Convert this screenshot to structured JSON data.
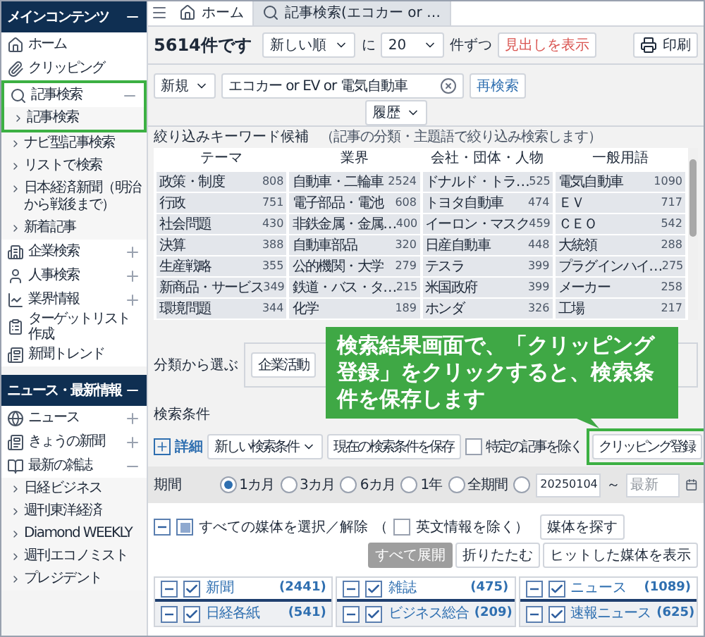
{
  "sidebar": {
    "sections": [
      {
        "title": "メインコンテンツ",
        "expanded": true,
        "items": [
          {
            "label": "ホーム"
          },
          {
            "label": "クリッピング"
          },
          {
            "label": "記事検索",
            "expanded": true,
            "highlighted": true,
            "children": [
              {
                "label": "記事検索"
              },
              {
                "label": "ナビ型記事検索"
              },
              {
                "label": "リストで検索"
              },
              {
                "label": "日本経済新聞（明治から戦後まで）"
              },
              {
                "label": "新着記事"
              }
            ]
          },
          {
            "label": "企業検索",
            "expanded": false
          },
          {
            "label": "人事検索",
            "expanded": false
          },
          {
            "label": "業界情報",
            "expanded": false
          },
          {
            "label": "ターゲットリスト作成"
          },
          {
            "label": "新聞トレンド"
          }
        ]
      },
      {
        "title": "ニュース・最新情報",
        "expanded": true,
        "items": [
          {
            "label": "ニュース",
            "expanded": false
          },
          {
            "label": "きょうの新聞",
            "expanded": false
          },
          {
            "label": "最新の雑誌",
            "expanded": true,
            "children": [
              {
                "label": "日経ビジネス"
              },
              {
                "label": "週刊東洋経済"
              },
              {
                "label": "Diamond WEEKLY"
              },
              {
                "label": "週刊エコノミスト"
              },
              {
                "label": "プレジデント"
              }
            ]
          }
        ]
      }
    ]
  },
  "tabs": [
    {
      "label": "ホーム",
      "selected": false
    },
    {
      "label": "記事検索(エコカー or …",
      "selected": true
    }
  ],
  "results": {
    "count": "5614件です",
    "sort": "新しい順",
    "sort_suffix": "に",
    "per_page": "20",
    "per_page_suffix": "件ずつ",
    "headline_button": "見出しを表示",
    "print_button": "印刷"
  },
  "search": {
    "mode": "新規",
    "query": "エコカー or EV or 電気自動車",
    "button": "再検索",
    "history": "履歴"
  },
  "keywords": {
    "title": "絞り込みキーワード候補",
    "note": "（記事の分類・主題語で絞り込み検索します）",
    "columns": [
      {
        "heading": "テーマ",
        "items": [
          {
            "label": "政策・制度",
            "count": "808"
          },
          {
            "label": "行政",
            "count": "751"
          },
          {
            "label": "社会問題",
            "count": "430"
          },
          {
            "label": "決算",
            "count": "388"
          },
          {
            "label": "生産戦略",
            "count": "355"
          },
          {
            "label": "新商品・サービス",
            "count": "349"
          },
          {
            "label": "環境問題",
            "count": "344"
          }
        ]
      },
      {
        "heading": "業界",
        "items": [
          {
            "label": "自動車・二輪車",
            "count": "2524"
          },
          {
            "label": "電子部品・電池",
            "count": "608"
          },
          {
            "label": "非鉄金属・金属…",
            "count": "400"
          },
          {
            "label": "自動車部品",
            "count": "320"
          },
          {
            "label": "公的機関・大学",
            "count": "279"
          },
          {
            "label": "鉄道・バス・タ…",
            "count": "215"
          },
          {
            "label": "化学",
            "count": "189"
          }
        ]
      },
      {
        "heading": "会社・団体・人物",
        "items": [
          {
            "label": "ドナルド・トラ…",
            "count": "525"
          },
          {
            "label": "トヨタ自動車",
            "count": "474"
          },
          {
            "label": "イーロン・マスク",
            "count": "459"
          },
          {
            "label": "日産自動車",
            "count": "448"
          },
          {
            "label": "テスラ",
            "count": "399"
          },
          {
            "label": "米国政府",
            "count": "399"
          },
          {
            "label": "ホンダ",
            "count": "326"
          }
        ]
      },
      {
        "heading": "一般用語",
        "items": [
          {
            "label": "電気自動車",
            "count": "1090"
          },
          {
            "label": "ＥＶ",
            "count": "717"
          },
          {
            "label": "ＣＥＯ",
            "count": "542"
          },
          {
            "label": "大統領",
            "count": "288"
          },
          {
            "label": "プラグインハイ…",
            "count": "275"
          },
          {
            "label": "メーカー",
            "count": "258"
          },
          {
            "label": "工場",
            "count": "217"
          }
        ]
      }
    ]
  },
  "classify": {
    "label": "分類から選ぶ",
    "buttons": [
      "企業活動"
    ]
  },
  "callout": {
    "text": "検索結果画面で、「クリッピング登録」をクリックすると、検索条件を保存します"
  },
  "conditions": {
    "label": "検索条件",
    "details": "詳細",
    "saved": "新しい検索条件",
    "save_button": "現在の検索条件を保存",
    "exclude": {
      "label": "特定の記事を除く",
      "checked": false
    },
    "clip_button": "クリッピング登録"
  },
  "period": {
    "label": "期間",
    "options": [
      {
        "label": "1カ月",
        "selected": true
      },
      {
        "label": "3カ月",
        "selected": false
      },
      {
        "label": "6カ月",
        "selected": false
      },
      {
        "label": "1年",
        "selected": false
      },
      {
        "label": "全期間",
        "selected": false
      },
      {
        "selected": false
      }
    ],
    "from": "20250104",
    "tilde": "～",
    "to_placeholder": "最新"
  },
  "media": {
    "select_all": {
      "label": "すべての媒体を選択／解除",
      "indeterminate": true
    },
    "paren": "（",
    "english": {
      "label": "英文情報を除く）",
      "checked": false
    },
    "find_button": "媒体を探す",
    "buttons": [
      {
        "label": "すべて展開",
        "disabled": true
      },
      {
        "label": "折りたたむ",
        "disabled": false
      },
      {
        "label": "ヒットした媒体を表示",
        "disabled": false
      }
    ],
    "groups": [
      {
        "label": "新聞",
        "count": "(2441)",
        "checked": true,
        "expanded": true,
        "children": [
          {
            "label": "日経各紙",
            "count": "(541)",
            "checked": true,
            "expanded": true
          }
        ]
      },
      {
        "label": "雑誌",
        "count": "(475)",
        "checked": true,
        "expanded": true,
        "children": [
          {
            "label": "ビジネス総合",
            "count": "(209)",
            "checked": true,
            "expanded": true
          }
        ]
      },
      {
        "label": "ニュース",
        "count": "(1089)",
        "checked": true,
        "expanded": true,
        "children": [
          {
            "label": "速報ニュース",
            "count": "(625)",
            "checked": true,
            "expanded": true
          }
        ]
      }
    ]
  }
}
